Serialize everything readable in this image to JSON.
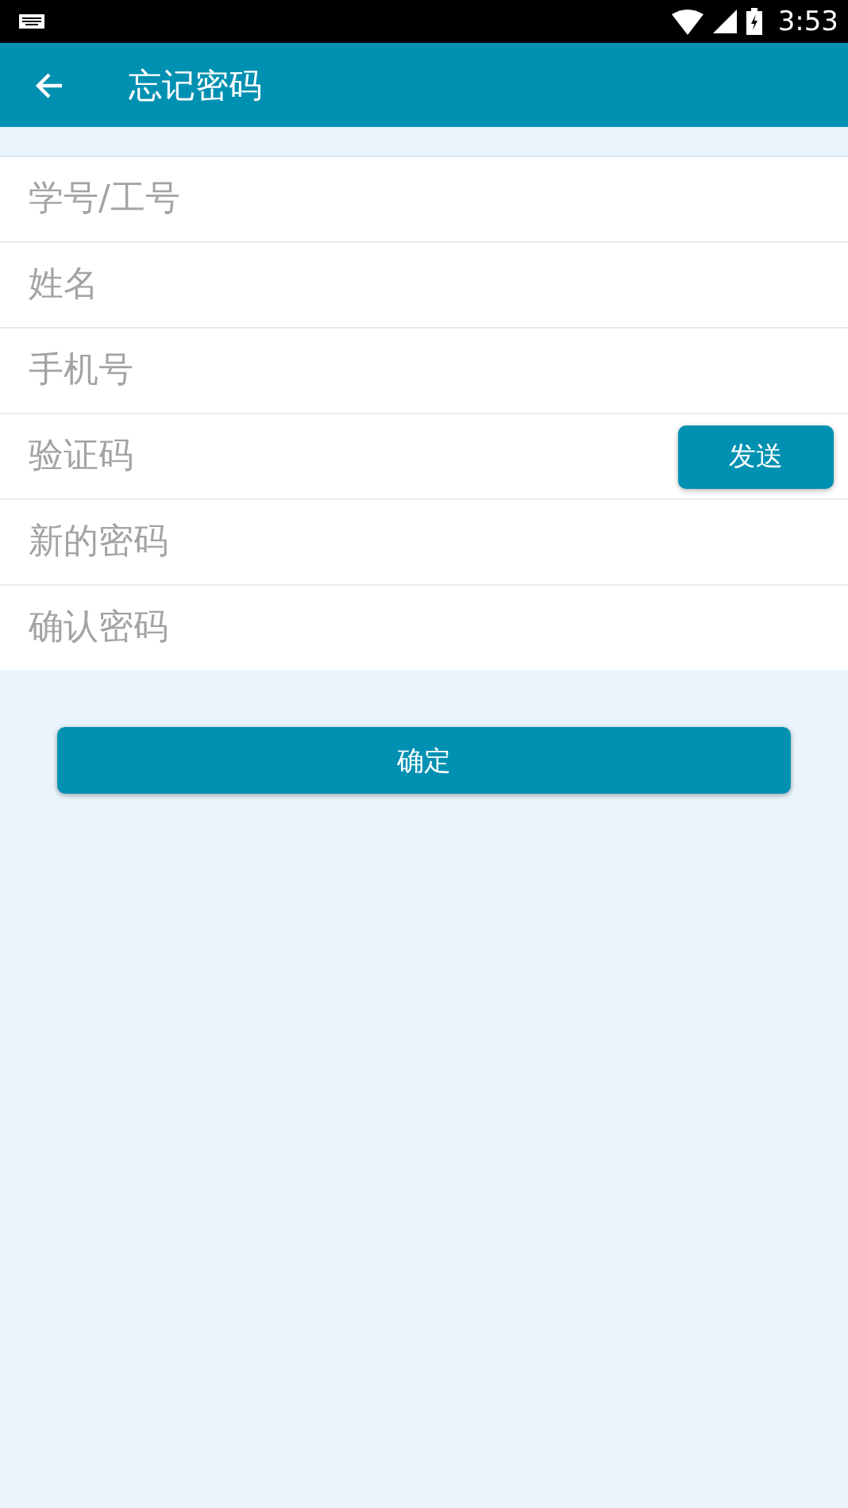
{
  "status_bar": {
    "time": "3:53"
  },
  "app_bar": {
    "title": "忘记密码"
  },
  "fields": [
    {
      "placeholder": "学号/工号",
      "kind": "text"
    },
    {
      "placeholder": "姓名",
      "kind": "text"
    },
    {
      "placeholder": "手机号",
      "kind": "text"
    },
    {
      "placeholder": "验证码",
      "kind": "code",
      "button": "发送"
    },
    {
      "placeholder": "新的密码",
      "kind": "text"
    },
    {
      "placeholder": "确认密码",
      "kind": "text"
    }
  ],
  "submit_button": "确定"
}
